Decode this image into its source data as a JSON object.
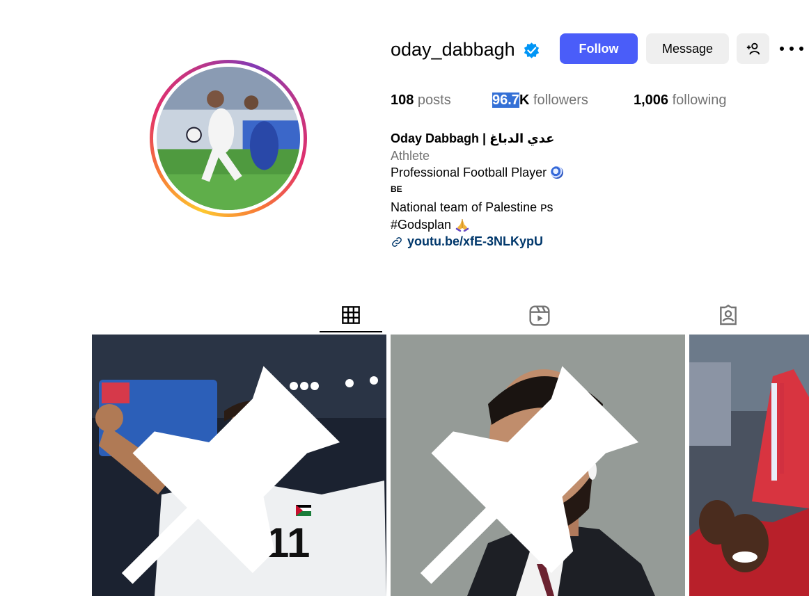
{
  "profile": {
    "username": "oday_dabbagh",
    "verified": true,
    "accent_color": "#4a5df9"
  },
  "actions": {
    "follow_label": "Follow",
    "message_label": "Message"
  },
  "stats": {
    "posts_count": "108",
    "posts_label": " posts",
    "followers_count_highlight": "96.7",
    "followers_count_rest": "K",
    "followers_label": " followers",
    "following_count": "1,006",
    "following_label": " following"
  },
  "bio": {
    "name": "Oday Dabbagh | عدي الدباغ",
    "category": "Athlete",
    "line1": "Professional Football Player",
    "line2": "BE",
    "line3": "National team of Palestine ᴘs",
    "line4": "#Godsplan",
    "link": "youtu.be/xfE-3NLKypU"
  },
  "tabs": [
    {
      "name": "posts",
      "icon": "grid-icon",
      "active": true
    },
    {
      "name": "reels",
      "icon": "reels-icon",
      "active": false
    },
    {
      "name": "tagged",
      "icon": "tagged-icon",
      "active": false
    }
  ],
  "posts": [
    {
      "pinned": true,
      "jersey_number": "11"
    },
    {
      "pinned": true
    },
    {
      "pinned": false
    }
  ]
}
